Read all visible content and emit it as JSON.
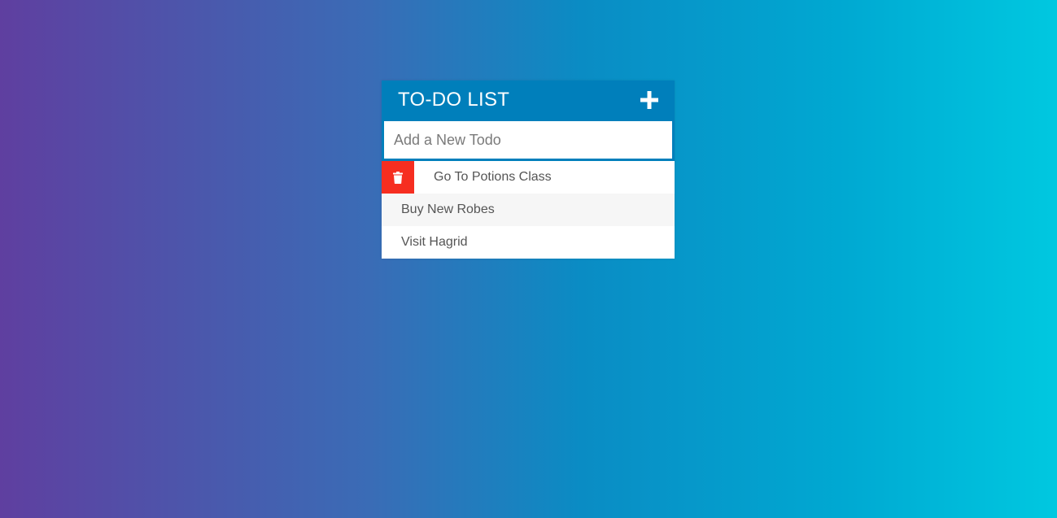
{
  "app": {
    "title": "TO-DO LIST"
  },
  "input": {
    "placeholder": "Add a New Todo"
  },
  "todos": [
    {
      "text": "Go To Potions Class",
      "delete_visible": true
    },
    {
      "text": "Buy New Robes",
      "delete_visible": false
    },
    {
      "text": "Visit Hagrid",
      "delete_visible": false
    }
  ],
  "icons": {
    "add": "plus-icon",
    "delete": "trash-icon"
  },
  "colors": {
    "header": "#007fbb",
    "delete": "#f62e20",
    "gradient_start": "#5f3fa0",
    "gradient_end": "#00c8e0"
  }
}
